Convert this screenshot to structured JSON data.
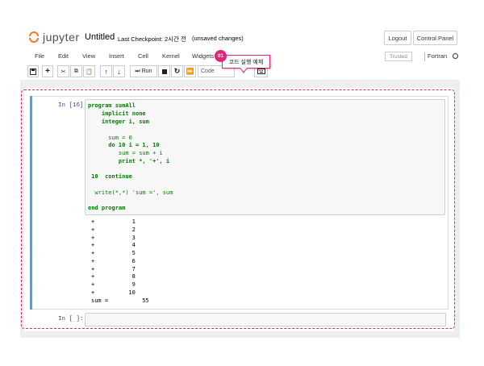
{
  "header": {
    "logo_text": "jupyter",
    "notebook_title": "Untitled",
    "checkpoint": "Last Checkpoint: 2시간 전",
    "unsaved": "(unsaved changes)",
    "logout_label": "Logout",
    "control_panel_label": "Control Panel"
  },
  "menubar": {
    "items": [
      "File",
      "Edit",
      "View",
      "Insert",
      "Cell",
      "Kernel",
      "Widgets"
    ],
    "trusted_label": "Trusted",
    "kernel_name": "Fortran"
  },
  "toolbar": {
    "save_icon": "floppy-icon",
    "buttons": [
      "+",
      "✂",
      "⧉",
      "📋",
      "↑",
      "↓"
    ],
    "run_label": "Run",
    "cell_type": "Code",
    "keyboard_icon": "keyboard-icon"
  },
  "callout": {
    "badge": "01",
    "text": "코드 실행 예제",
    "accent_color": "#e0257b"
  },
  "cell": {
    "prompt": "In [16]:",
    "code_lines": [
      "program sumAll",
      "    implicit none",
      "    integer i, sum",
      "",
      "      sum = 0",
      "      do 10 i = 1, 10",
      "         sum = sum + i",
      "         print *, '+', i",
      "",
      " 10  continue",
      "",
      "  write(*,*) 'sum =', sum",
      "",
      "end program"
    ],
    "output_lines": [
      "+           1",
      "+           2",
      "+           3",
      "+           4",
      "+           5",
      "+           6",
      "+           7",
      "+           8",
      "+           9",
      "+          10",
      "sum =          55"
    ]
  },
  "empty_cell": {
    "prompt": "In [ ]:"
  }
}
